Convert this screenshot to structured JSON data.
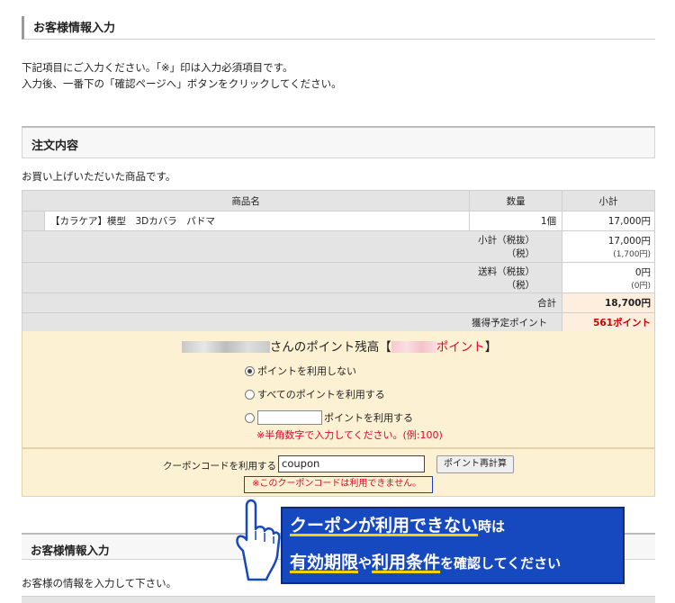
{
  "page": {
    "title": "お客様情報入力",
    "intro_line1": "下記項目にご入力ください。「※」印は入力必須項目です。",
    "intro_line2": "入力後、一番下の「確認ページへ」ボタンをクリックしてください。"
  },
  "order": {
    "heading": "注文内容",
    "lead": "お買い上げいただいた商品です。",
    "columns": {
      "product": "商品名",
      "qty": "数量",
      "subtotal": "小計"
    },
    "item": {
      "name": "【カラケア】模型　3Dカバラ　パドマ",
      "qty": "1個",
      "subtotal": "17,000円"
    },
    "subtotal_label_1": "小計（税抜）",
    "subtotal_label_2": "（税）",
    "subtotal_value_1": "17,000円",
    "subtotal_value_2": "(1,700円)",
    "shipping_label_1": "送料（税抜）",
    "shipping_label_2": "（税）",
    "shipping_value_1": "0円",
    "shipping_value_2": "(0円)",
    "total_label": "合計",
    "total_value": "18,700円",
    "points_label": "獲得予定ポイント",
    "points_value": "561ポイント"
  },
  "points_panel": {
    "title_suffix": "さんのポイント残高【",
    "points_word": "ポイント",
    "title_close": "】",
    "option_none": "ポイントを利用しない",
    "option_all": "すべてのポイントを利用する",
    "option_some": "ポイントを利用する",
    "warning": "※半角数字で入力してください。(例:100)"
  },
  "coupon": {
    "label": "クーポンコードを利用する",
    "value": "coupon",
    "recalc_button": "ポイント再計算",
    "error": "※このクーポンコードは利用できません。"
  },
  "callout": {
    "line1_main": "クーポンが利用できない",
    "line1_tail": "時は",
    "line2_a": "有効期限",
    "line2_b": "や",
    "line2_c": "利用条件",
    "line2_d": "を確認してください"
  },
  "customer": {
    "heading": "お客様情報入力",
    "lead": "お客様の情報を入力して下さい。"
  }
}
